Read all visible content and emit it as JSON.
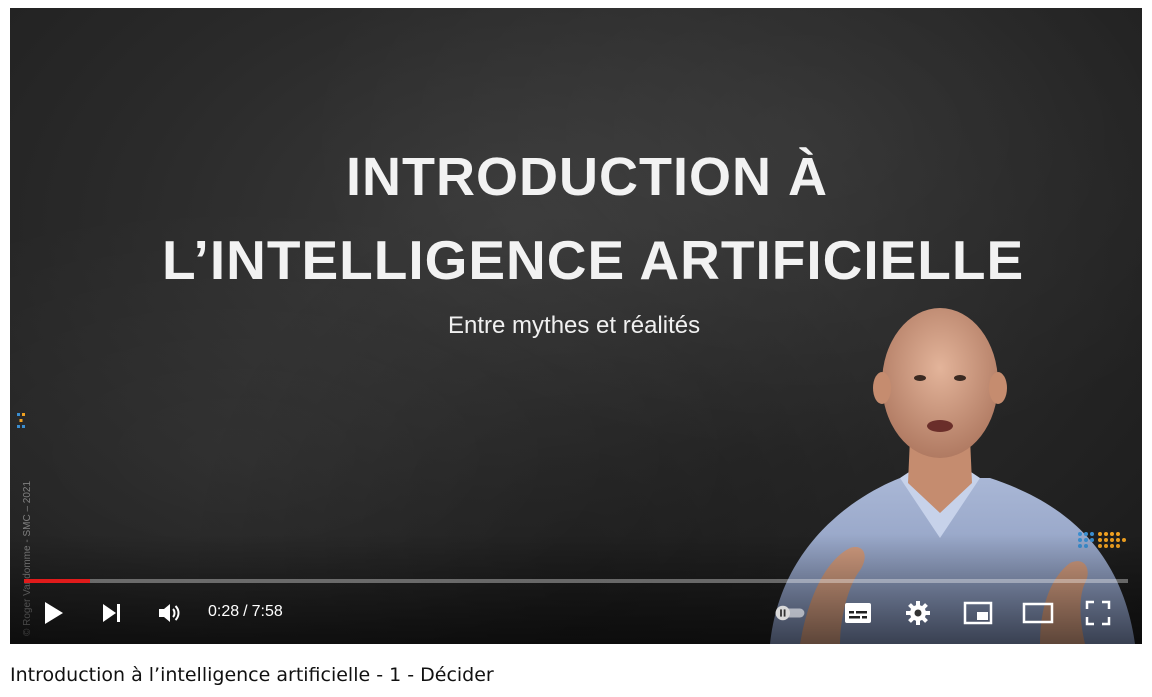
{
  "video": {
    "slide": {
      "title_line_1": "INTRODUCTION À",
      "title_line_2": "L’INTELLIGENCE ARTIFICIELLE",
      "subtitle": "Entre mythes et réalités"
    },
    "watermark": "© Roger Vandomme - SMC – 2021",
    "controls": {
      "current_time": "0:28",
      "separator": "/",
      "duration": "7:58",
      "progress_fraction": 0.06,
      "icons": {
        "play": "play-icon",
        "next": "next-icon",
        "volume": "volume-icon",
        "autoplay": "autoplay-toggle-icon",
        "subtitles": "subtitles-icon",
        "settings": "gear-icon",
        "miniplayer": "miniplayer-icon",
        "theater": "theater-mode-icon",
        "fullscreen": "fullscreen-icon"
      }
    },
    "colors": {
      "progress": "#e01b1b",
      "background": "#2a2a2a"
    }
  },
  "page": {
    "video_title": "Introduction à l’intelligence artificielle - 1 - Décider"
  }
}
